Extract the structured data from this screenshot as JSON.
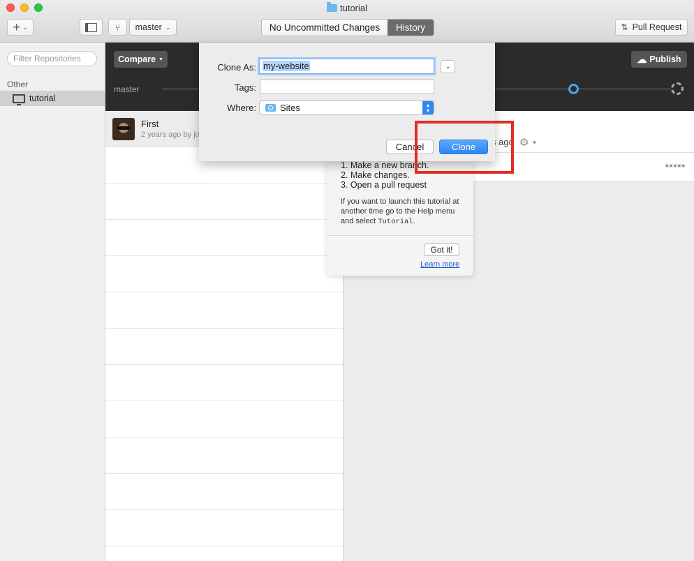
{
  "window": {
    "title": "tutorial"
  },
  "toolbar": {
    "add_icon": "plus-icon",
    "branch": "master",
    "tabs": [
      "No Uncommitted Changes",
      "History"
    ],
    "active_tab": "History",
    "pull_request": "Pull Request"
  },
  "sidebar": {
    "filter_placeholder": "Filter Repositories",
    "group_label": "Other",
    "repos": [
      {
        "name": "tutorial",
        "icon": "monitor-icon"
      }
    ]
  },
  "branchbar": {
    "compare": "Compare",
    "publish": "Publish",
    "branch_label": "master"
  },
  "commits": [
    {
      "title": "First",
      "subtitle": "2 years ago by jo"
    }
  ],
  "detail": {
    "ago_text": "s ago"
  },
  "tutorial": {
    "steps": [
      "1. Make a new branch.",
      "2. Make changes.",
      "3. Open a pull request"
    ],
    "note_before": "If you want to launch this tutorial at another time go to the Help menu and select ",
    "note_code": "Tutorial",
    "note_after": ".",
    "got_it": "Got it!",
    "learn_more": "Learn more"
  },
  "clone_sheet": {
    "clone_as_label": "Clone As:",
    "clone_as_value": "my-website",
    "tags_label": "Tags:",
    "tags_value": "",
    "where_label": "Where:",
    "where_value": "Sites",
    "cancel": "Cancel",
    "clone": "Clone"
  },
  "colors": {
    "accent": "#2b86f3",
    "highlight": "#e32c22",
    "dark_bar": "#2b2b2b"
  }
}
